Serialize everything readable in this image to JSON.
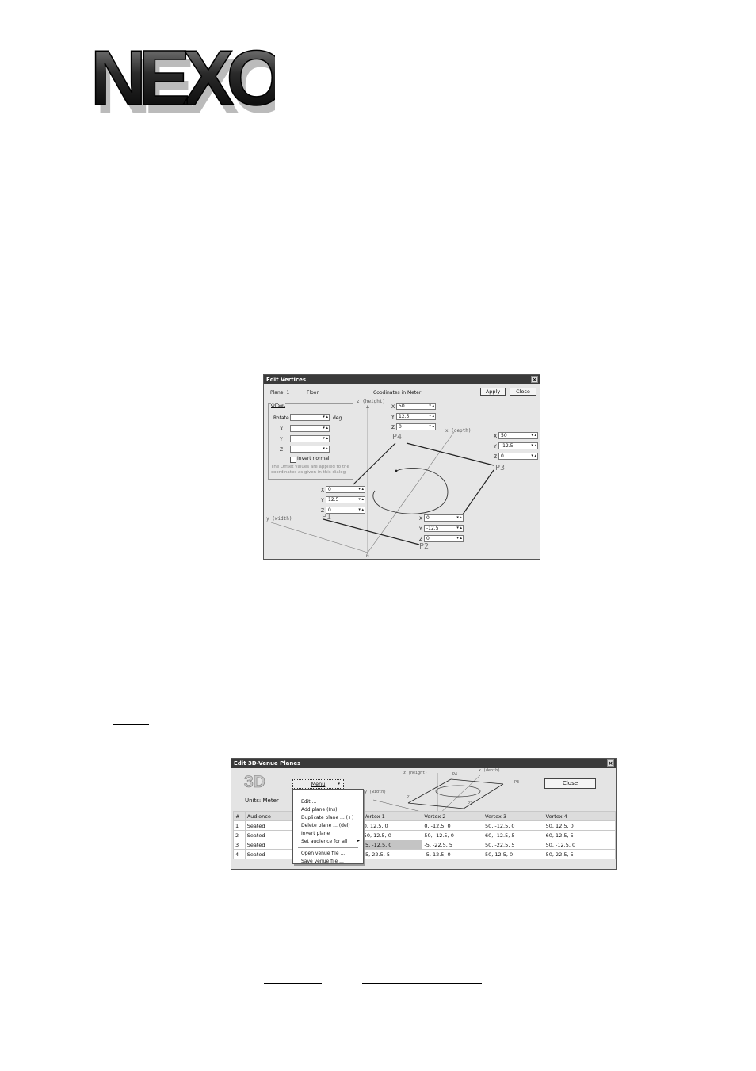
{
  "logo": {
    "text": "NEXO"
  },
  "edit_vertices": {
    "title": "Edit Vertices",
    "plane_label": "Plane: 1",
    "plane_name": "Floor",
    "coords": "Coodinates in Meter",
    "apply": "Apply",
    "close": "Close",
    "offset": {
      "title": "Offset",
      "rotate_label": "Rotate",
      "rotate_unit": "deg",
      "x_label": "X",
      "y_label": "Y",
      "z_label": "Z",
      "invert_normal": "Invert normal",
      "note_line1": "The Offset values are applied to the",
      "note_line2": "coordinates as given in this dialog"
    },
    "axes": {
      "z": "z (height)",
      "x": "x (depth)",
      "y": "y (width)",
      "origin": "0"
    },
    "points": {
      "p1": "P1",
      "p2": "P2",
      "p3": "P3",
      "p4": "P4",
      "p1_vals": {
        "x": "0",
        "y": "12.5",
        "z": "0"
      },
      "p2_vals": {
        "x": "0",
        "y": "-12.5",
        "z": "0"
      },
      "p3_vals": {
        "x": "50",
        "y": "-12.5",
        "z": "0"
      },
      "p4_vals": {
        "x": "50",
        "y": "12.5",
        "z": "0"
      },
      "x_lbl": "X",
      "y_lbl": "Y",
      "z_lbl": "Z"
    }
  },
  "venue_planes": {
    "title": "Edit 3D-Venue Planes",
    "logo3d": "3D",
    "units": "Units: Meter",
    "menu_btn": "Menu",
    "close": "Close",
    "mini_axes": {
      "z": "z (height)",
      "x": "x (depth)",
      "y": "y (width)",
      "p1": "P1",
      "p2": "P2",
      "p3": "P3",
      "p4": "P4"
    },
    "menu_items": [
      "Edit ...",
      "Add plane (Ins)",
      "Duplicate plane ... (+)",
      "Delete plane ... (del)",
      "Invert plane",
      "Set audience for all",
      "Open venue file ...",
      "Save venue file ..."
    ],
    "submenu_arrow": "▸",
    "columns": [
      "#",
      "Audience",
      "",
      "Vertex 1",
      "Vertex 2",
      "Vertex 3",
      "Vertex 4"
    ],
    "rows": [
      [
        "1",
        "Seated",
        "",
        "0, 12.5, 0",
        "0, -12.5, 0",
        "50, -12.5, 0",
        "50, 12.5, 0"
      ],
      [
        "2",
        "Seated",
        "",
        "50, 12.5, 0",
        "50, -12.5, 0",
        "60, -12.5, 5",
        "60, 12.5, 5"
      ],
      [
        "3",
        "Seated",
        "",
        "-5, -12.5, 0",
        "-5, -22.5, 5",
        "50, -22.5, 5",
        "50, -12.5, 0"
      ],
      [
        "4",
        "Seated",
        "",
        "-5, 22.5, 5",
        "-5, 12.5, 0",
        "50, 12.5, 0",
        "50, 22.5, 5"
      ]
    ]
  }
}
